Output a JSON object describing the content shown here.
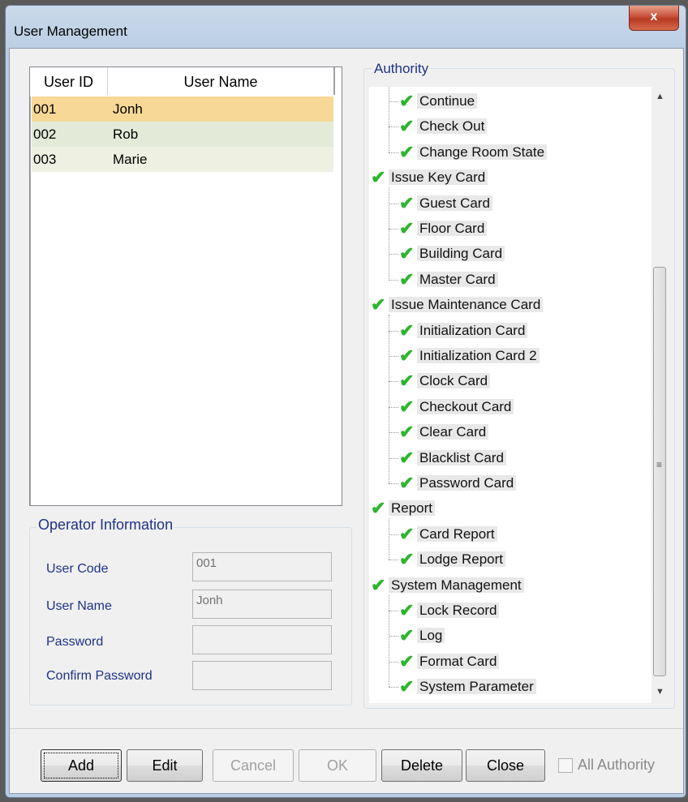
{
  "window": {
    "title": "User Management",
    "close_label": "x"
  },
  "users": {
    "columns": [
      "User ID",
      "User Name"
    ],
    "rows": [
      {
        "id": "001",
        "name": "Jonh",
        "bg": "#f7d896"
      },
      {
        "id": "002",
        "name": "Rob",
        "bg": "#e3ebd8"
      },
      {
        "id": "003",
        "name": "Marie",
        "bg": "#eef0e2"
      }
    ]
  },
  "operator": {
    "title": "Operator Information",
    "user_code_label": "User Code",
    "user_code_value": "001",
    "user_name_label": "User Name",
    "user_name_value": "Jonh",
    "password_label": "Password",
    "password_value": "",
    "confirm_label": "Confirm Password",
    "confirm_value": ""
  },
  "authority": {
    "title": "Authority",
    "items": [
      {
        "label": "Continue",
        "level": 1
      },
      {
        "label": "Check Out",
        "level": 1
      },
      {
        "label": "Change Room State",
        "level": 1
      },
      {
        "label": "Issue Key Card",
        "level": 0
      },
      {
        "label": "Guest Card",
        "level": 1
      },
      {
        "label": "Floor Card",
        "level": 1
      },
      {
        "label": "Building Card",
        "level": 1
      },
      {
        "label": "Master Card",
        "level": 1
      },
      {
        "label": "Issue Maintenance Card",
        "level": 0
      },
      {
        "label": "Initialization Card",
        "level": 1
      },
      {
        "label": "Initialization Card 2",
        "level": 1
      },
      {
        "label": "Clock Card",
        "level": 1
      },
      {
        "label": "Checkout Card",
        "level": 1
      },
      {
        "label": "Clear Card",
        "level": 1
      },
      {
        "label": "Blacklist Card",
        "level": 1
      },
      {
        "label": "Password Card",
        "level": 1
      },
      {
        "label": "Report",
        "level": 0
      },
      {
        "label": "Card Report",
        "level": 1
      },
      {
        "label": "Lodge Report",
        "level": 1
      },
      {
        "label": "System Management",
        "level": 0
      },
      {
        "label": "Lock Record",
        "level": 1
      },
      {
        "label": "Log",
        "level": 1
      },
      {
        "label": "Format Card",
        "level": 1
      },
      {
        "label": "System Parameter",
        "level": 1
      }
    ],
    "check_color": "#2db52d"
  },
  "buttons": {
    "add": "Add",
    "edit": "Edit",
    "cancel": "Cancel",
    "ok": "OK",
    "delete": "Delete",
    "close": "Close"
  },
  "all_authority": {
    "label": "All Authority",
    "checked": false
  }
}
